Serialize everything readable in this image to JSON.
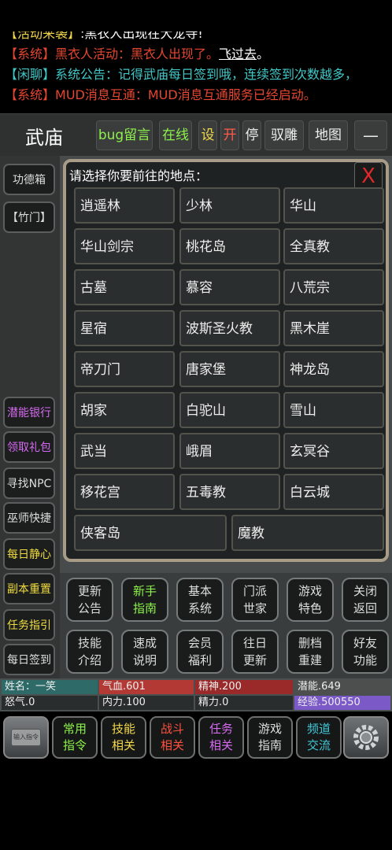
{
  "chat": [
    {
      "tag": "【活动来袭】",
      "text": ":黑衣人出现在大龙寺!",
      "color": "yel"
    },
    {
      "tag": "【系统】",
      "text": "黑衣人活动：黑衣人出现了。",
      "link": "飞过去",
      "tail": "。",
      "color": "red"
    },
    {
      "tag": "【闲聊】",
      "text": "系统公告：记得武庙每日签到哦，连续签到次数越多，",
      "color": "cyan"
    },
    {
      "tag": "【系统】",
      "text": "MUD消息互通：MUD消息互通服务已经启动。",
      "color": "red"
    }
  ],
  "header": {
    "room": "武庙",
    "bug": "bug留言",
    "online": "在线",
    "set": "设",
    "open": "开",
    "stop": "停",
    "ride": "驭雕",
    "map": "地图",
    "collapse": "—"
  },
  "left": {
    "merit": "功德箱",
    "bamboo_door": "【竹门】",
    "potential_bank": "潜能银行",
    "gift": "领取礼包",
    "find_npc": "寻找NPC",
    "wizard": "巫师快捷",
    "meditate": "每日静心",
    "reset_dungeon": "副本重置",
    "task_guide": "任务指引",
    "signin": "每日签到"
  },
  "dialog": {
    "title": "请选择你要前往的地点：",
    "close": "X",
    "places": [
      "逍遥林",
      "少林",
      "华山",
      "华山剑宗",
      "桃花岛",
      "全真教",
      "古墓",
      "慕容",
      "八荒宗",
      "星宿",
      "波斯圣火教",
      "黑木崖",
      "帝刀门",
      "唐家堡",
      "神龙岛",
      "胡家",
      "白驼山",
      "雪山",
      "武当",
      "峨眉",
      "玄冥谷",
      "移花宫",
      "五毒教",
      "白云城",
      "侠客岛",
      "魔教"
    ]
  },
  "grid": {
    "row1": [
      [
        "更新",
        "公告"
      ],
      [
        "新手",
        "指南"
      ],
      [
        "基本",
        "系统"
      ],
      [
        "门派",
        "世家"
      ],
      [
        "游戏",
        "特色"
      ],
      [
        "关闭",
        "返回"
      ]
    ],
    "row2": [
      [
        "技能",
        "介绍"
      ],
      [
        "速成",
        "说明"
      ],
      [
        "会员",
        "福利"
      ],
      [
        "往日",
        "更新"
      ],
      [
        "删档",
        "重建"
      ],
      [
        "好友",
        "功能"
      ]
    ]
  },
  "stats": {
    "name": "姓名：一笑",
    "hp": "气血.601",
    "spirit": "精神.200",
    "potential": "潜能.649",
    "rage": "怒气.0",
    "neili": "内力.100",
    "jingli": "精力.0",
    "exp": "经验.500550"
  },
  "stat_fill": {
    "hp": 1.0,
    "spirit": 1.0,
    "potential": 1.0,
    "rage": 0.0,
    "neili": 0.0,
    "jingli": 0.0,
    "exp": 1.0
  },
  "colors": {
    "hp": "#b33a34",
    "spirit": "#9a2a2a",
    "potential": "#4d4f4f",
    "exp": "#7b59c7",
    "name": "#2e6b68"
  },
  "footer": {
    "input": "输入指令",
    "common": [
      "常用",
      "指令"
    ],
    "skills": [
      "技能",
      "相关"
    ],
    "battle": [
      "战斗",
      "相关"
    ],
    "quest": [
      "任务",
      "相关"
    ],
    "guide": [
      "游戏",
      "指南"
    ],
    "channel": [
      "频道",
      "交流"
    ]
  }
}
